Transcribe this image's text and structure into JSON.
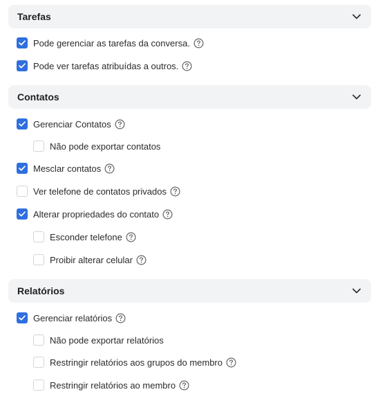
{
  "sections": {
    "tarefas": {
      "title": "Tarefas",
      "items": [
        {
          "label": "Pode gerenciar as tarefas da conversa.",
          "checked": true,
          "help": true
        },
        {
          "label": "Pode ver tarefas atribuídas a outros.",
          "checked": true,
          "help": true
        }
      ]
    },
    "contatos": {
      "title": "Contatos",
      "items": [
        {
          "label": "Gerenciar Contatos",
          "checked": true,
          "help": true
        },
        {
          "label": "Não pode exportar contatos",
          "checked": false,
          "help": false
        },
        {
          "label": "Mesclar contatos",
          "checked": true,
          "help": true
        },
        {
          "label": "Ver telefone de contatos privados",
          "checked": false,
          "help": true
        },
        {
          "label": "Alterar propriedades do contato",
          "checked": true,
          "help": true
        },
        {
          "label": "Esconder telefone",
          "checked": false,
          "help": true
        },
        {
          "label": "Proibir alterar celular",
          "checked": false,
          "help": true
        }
      ]
    },
    "relatorios": {
      "title": "Relatórios",
      "items": [
        {
          "label": "Gerenciar relatórios",
          "checked": true,
          "help": true
        },
        {
          "label": "Não pode exportar relatórios",
          "checked": false,
          "help": false
        },
        {
          "label": "Restringir relatórios aos grupos do membro",
          "checked": false,
          "help": true
        },
        {
          "label": "Restringir relatórios ao membro",
          "checked": false,
          "help": true
        }
      ]
    }
  },
  "colors": {
    "checkbox_checked": "#2f6fdf",
    "header_bg": "#f2f3f5"
  },
  "icons": {
    "section_toggle": "chevron-down-icon",
    "help": "question-circle-icon",
    "check": "checkmark-icon"
  }
}
